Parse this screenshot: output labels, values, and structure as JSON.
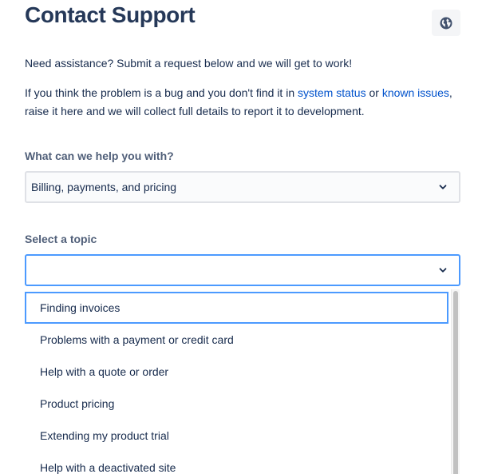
{
  "header": {
    "title": "Contact Support",
    "language_icon": "globe-icon"
  },
  "intro": {
    "text": "Need assistance? Submit a request below and we will get to work!"
  },
  "bug_notice": {
    "before": "If you think the problem is a bug and you don't find it in ",
    "link_status": "system status",
    "between": " or ",
    "link_issues": "known issues",
    "after": ", raise it here and we will collect full details to report it to development."
  },
  "help_field": {
    "label": "What can we help you with?",
    "value": "Billing, payments, and pricing",
    "icon": "chevron-down-icon"
  },
  "topic_field": {
    "label": "Select a topic",
    "value": "",
    "icon": "chevron-down-icon",
    "options": [
      "Finding invoices",
      "Problems with a payment or credit card",
      "Help with a quote or order",
      "Product pricing",
      "Extending my product trial",
      "Help with a deactivated site"
    ],
    "focused_index": 0
  },
  "colors": {
    "title": "#253858",
    "text": "#172b4d",
    "link": "#0052cc",
    "label": "#505f79",
    "focus_border": "#4c9aff",
    "field_border": "#dfe1e6"
  }
}
